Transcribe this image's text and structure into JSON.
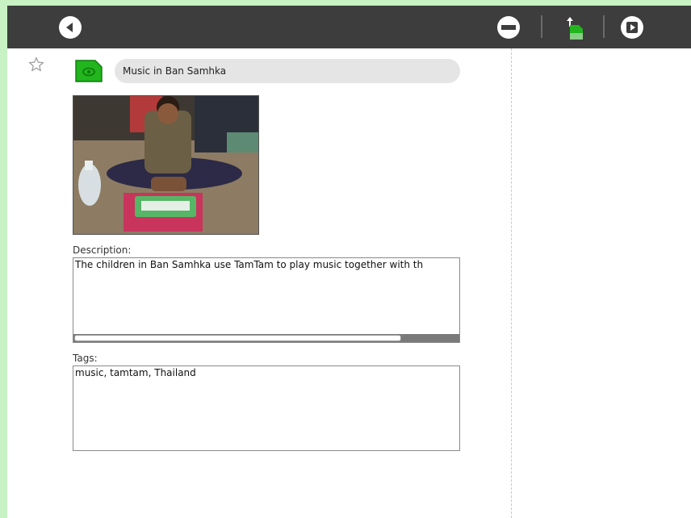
{
  "toolbar": {
    "back_icon": "back-arrow-icon",
    "erase_icon": "erase-entry-icon",
    "copy_icon": "copy-to-device-icon",
    "resume_icon": "resume-activity-icon"
  },
  "entry": {
    "starred": false,
    "activity_icon": "activity-icon",
    "activity_color": "#22b51e",
    "title": "Music in Ban Samhka"
  },
  "description": {
    "label": "Description:",
    "text": "The children in Ban Samhka use TamTam to play music together with th",
    "scroll_fraction": 0.85
  },
  "tags": {
    "label": "Tags:",
    "text": "music, tamtam, Thailand"
  }
}
